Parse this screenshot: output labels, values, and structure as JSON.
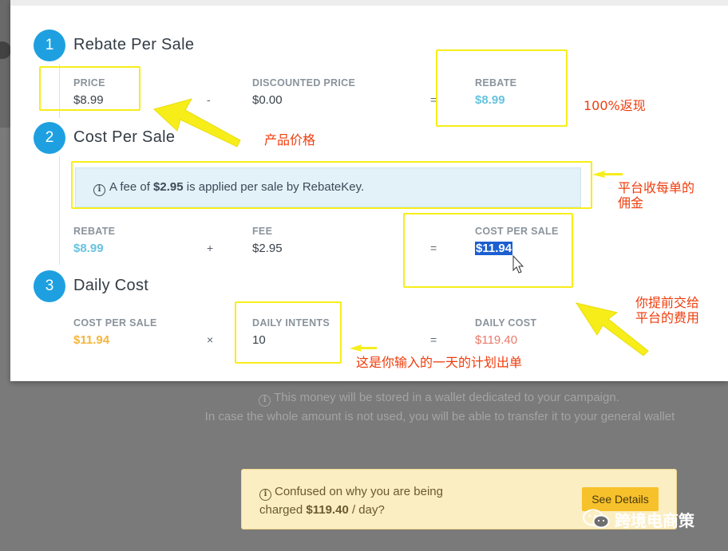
{
  "background": {
    "wallet_note_line1": "This money will be stored in a wallet dedicated to your campaign.",
    "wallet_note_line2": "In case the whole amount is not used, you will be able to transfer it to your general wallet",
    "confused_prefix": "Confused on why you are being",
    "confused_charged": "charged",
    "confused_amount": "$119.40",
    "confused_suffix": "/ day?",
    "see_details_label": "See Details"
  },
  "modal": {
    "steps": [
      {
        "number": "1",
        "title": "Rebate Per Sale",
        "left_label": "PRICE",
        "left_value": "$8.99",
        "op": "-",
        "mid_label": "DISCOUNTED PRICE",
        "mid_value": "$0.00",
        "eq": "=",
        "right_label": "REBATE",
        "right_value": "$8.99"
      },
      {
        "number": "2",
        "title": "Cost Per Sale",
        "fee_notice_prefix": "A fee of",
        "fee_notice_amount": "$2.95",
        "fee_notice_suffix": "is applied per sale by RebateKey.",
        "left_label": "REBATE",
        "left_value": "$8.99",
        "op": "+",
        "mid_label": "FEE",
        "mid_value": "$2.95",
        "eq": "=",
        "right_label": "COST PER SALE",
        "right_value": "$11.94"
      },
      {
        "number": "3",
        "title": "Daily Cost",
        "left_label": "COST PER SALE",
        "left_value": "$11.94",
        "op": "×",
        "mid_label": "DAILY INTENTS",
        "mid_value": "10",
        "eq": "=",
        "right_label": "DAILY COST",
        "right_value": "$119.40"
      }
    ]
  },
  "annotations": {
    "rebate_100": "100%返现",
    "product_price": "产品价格",
    "platform_fee_line1": "平台收每单的",
    "platform_fee_line2": "佣金",
    "prepay_line1": "你提前交给",
    "prepay_line2": "平台的费用",
    "daily_plan": "这是你输入的一天的计划出单"
  },
  "watermark": {
    "text": "跨境电商策"
  },
  "colors": {
    "accent_blue": "#1ea0e0",
    "rebate_blue": "#67c3df",
    "cost_orange": "#f6b53a",
    "daily_red": "#e87a6a",
    "annotation_yellow": "#f7ee19",
    "annotation_red": "#f03c0c"
  }
}
